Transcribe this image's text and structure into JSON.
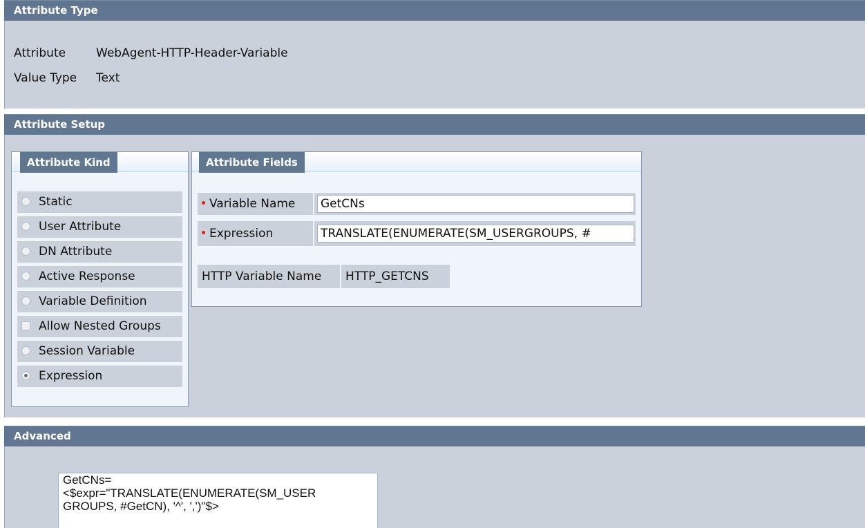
{
  "attribute_type": {
    "header": "Attribute Type",
    "attribute_label": "Attribute",
    "attribute_value": "WebAgent-HTTP-Header-Variable",
    "value_type_label": "Value Type",
    "value_type_value": "Text"
  },
  "attribute_setup": {
    "header": "Attribute Setup",
    "kind": {
      "title": "Attribute Kind",
      "options": [
        {
          "label": "Static",
          "control": "radio",
          "checked": false
        },
        {
          "label": "User Attribute",
          "control": "radio",
          "checked": false
        },
        {
          "label": "DN Attribute",
          "control": "radio",
          "checked": false
        },
        {
          "label": "Active Response",
          "control": "radio",
          "checked": false
        },
        {
          "label": "Variable Definition",
          "control": "radio",
          "checked": false
        },
        {
          "label": "Allow Nested Groups",
          "control": "checkbox",
          "checked": false
        },
        {
          "label": "Session Variable",
          "control": "radio",
          "checked": false
        },
        {
          "label": "Expression",
          "control": "radio",
          "checked": true
        }
      ]
    },
    "fields": {
      "title": "Attribute Fields",
      "variable_name_label": "Variable Name",
      "variable_name_value": "GetCNs",
      "expression_label": "Expression",
      "expression_value": "TRANSLATE(ENUMERATE(SM_USERGROUPS, #",
      "http_variable_label": "HTTP Variable Name",
      "http_variable_value": "HTTP_GETCNS"
    }
  },
  "advanced": {
    "header": "Advanced",
    "text": "GetCNs=\n<$expr=\"TRANSLATE(ENUMERATE(SM_USER\nGROUPS, #GetCN), '^', ',')\"$>"
  },
  "colors": {
    "header_bg": "#617691",
    "panel_bg": "#cad1db",
    "required_dot": "#dd2222"
  }
}
